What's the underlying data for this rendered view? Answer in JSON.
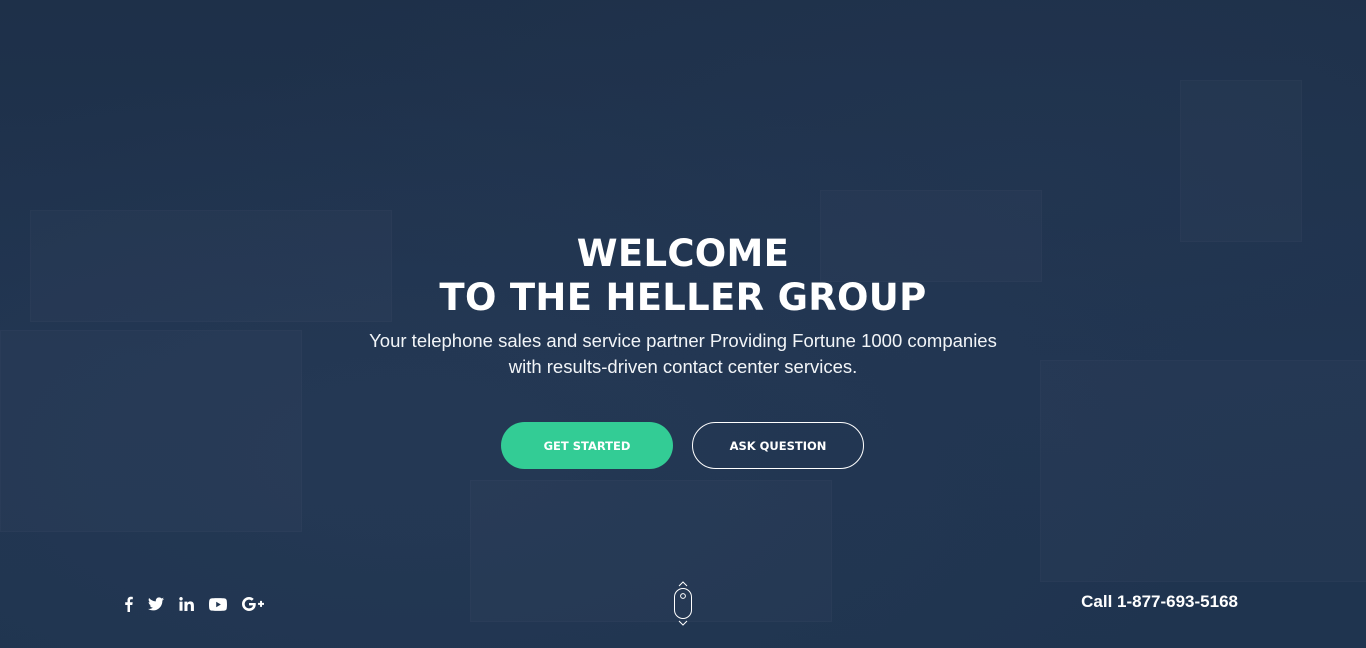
{
  "hero": {
    "title_line1": "WELCOME",
    "title_line2": "TO THE HELLER GROUP",
    "subtitle_line1": "Your telephone sales and service partner Providing Fortune 1000 companies",
    "subtitle_line2": "with results-driven contact center services."
  },
  "buttons": {
    "get_started": "GET STARTED",
    "ask_question": "ASK QUESTION"
  },
  "social": [
    {
      "name": "facebook-icon"
    },
    {
      "name": "twitter-icon"
    },
    {
      "name": "linkedin-icon"
    },
    {
      "name": "youtube-icon"
    },
    {
      "name": "google-plus-icon"
    }
  ],
  "footer": {
    "phone": "Call 1-877-693-5168"
  },
  "colors": {
    "background": "#1f324b",
    "accent": "#33cc95",
    "text": "#ffffff"
  }
}
